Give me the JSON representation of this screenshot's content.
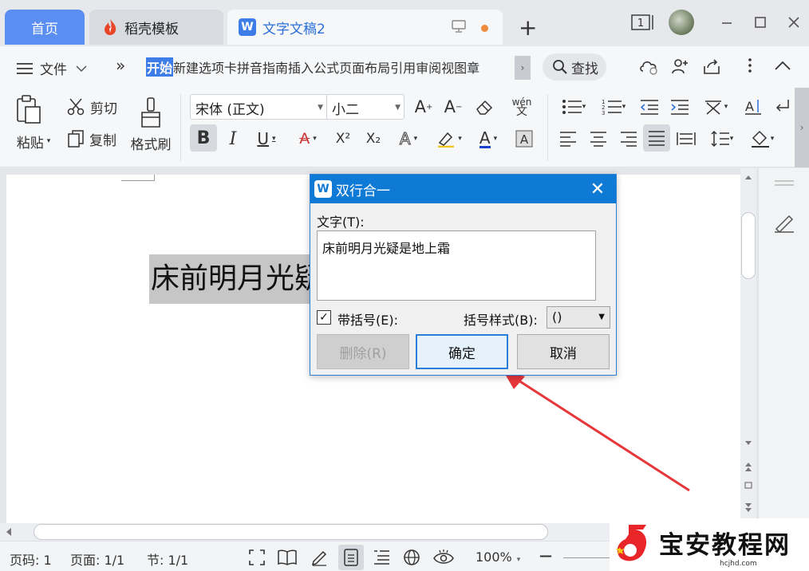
{
  "tabs": {
    "home": "首页",
    "template": "稻壳模板",
    "doc": "文字文稿2",
    "add": "+"
  },
  "window": {
    "page_count": "1"
  },
  "menu": {
    "hamburger": "≡",
    "file": "文件",
    "more": "»",
    "ribbon_tabs": [
      "开始",
      "新建选项卡",
      "拼音指南",
      "插入",
      "公式",
      "页面布局",
      "引用",
      "审阅",
      "视图",
      "章"
    ],
    "scroll": "›",
    "search": "查找"
  },
  "ribbon": {
    "paste": "粘贴",
    "cut": "剪切",
    "copy": "复制",
    "format_painter": "格式刷",
    "font_name": "宋体 (正文)",
    "font_size": "小二",
    "bold": "B",
    "italic": "I",
    "underline": "U",
    "pinyin": "wén",
    "superscript": "X²",
    "subscript": "X₂",
    "right_more": "›"
  },
  "document": {
    "text": "床前明月光疑是地上霜"
  },
  "dialog": {
    "title": "双行合一",
    "close": "✕",
    "text_label": "文字(T):",
    "text_value": "床前明月光疑是地上霜",
    "checkbox_label": "带括号(E):",
    "checkbox_checked": true,
    "bracket_style_label": "括号样式(B):",
    "bracket_style_value": "()",
    "delete_btn": "删除(R)",
    "ok_btn": "确定",
    "cancel_btn": "取消"
  },
  "status": {
    "page_num": "页码: 1",
    "page": "页面: 1/1",
    "section": "节: 1/1",
    "zoom": "100%",
    "zoom_minus": "—"
  },
  "watermark": {
    "title": "宝安教程网",
    "url": "hcjhd.com"
  },
  "colors": {
    "accent": "#3d7de8",
    "dialog_title": "#0f7ad6",
    "arrow": "#e8373a",
    "highlight": "#c6c6c6"
  }
}
